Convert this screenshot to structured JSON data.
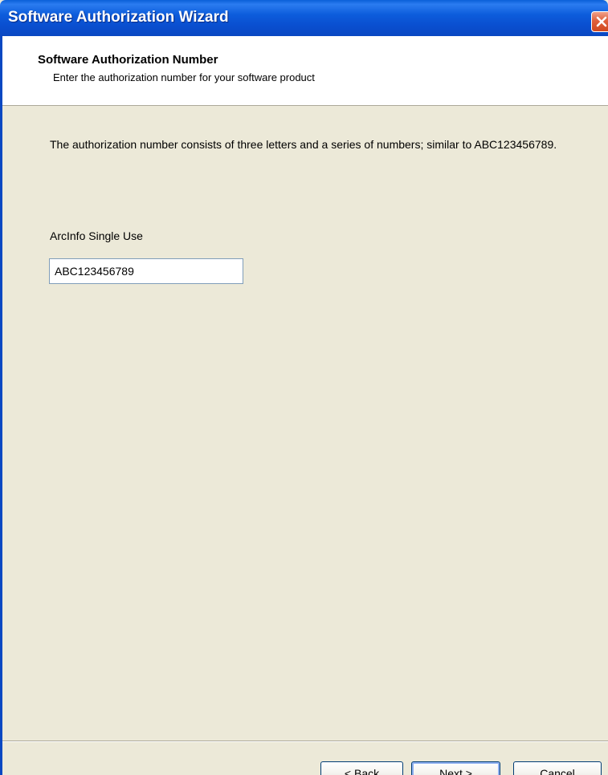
{
  "window": {
    "title": "Software Authorization Wizard",
    "close_icon": "close-icon"
  },
  "header": {
    "title": "Software Authorization Number",
    "subtitle": "Enter the authorization number for your software product"
  },
  "body": {
    "description": "The authorization number consists of three letters and a series of numbers; similar to ABC123456789.",
    "field_label": "ArcInfo Single Use",
    "field_value": "ABC123456789"
  },
  "buttons": {
    "back_mnemonic": "B",
    "back_rest": "ack",
    "back_prefix": "< ",
    "next_mnemonic": "N",
    "next_rest": "ext >",
    "cancel": "Cancel"
  },
  "colors": {
    "titlebar": "#0a4fd0",
    "dialog_bg": "#ece9d8",
    "close_button": "#e0603c"
  }
}
